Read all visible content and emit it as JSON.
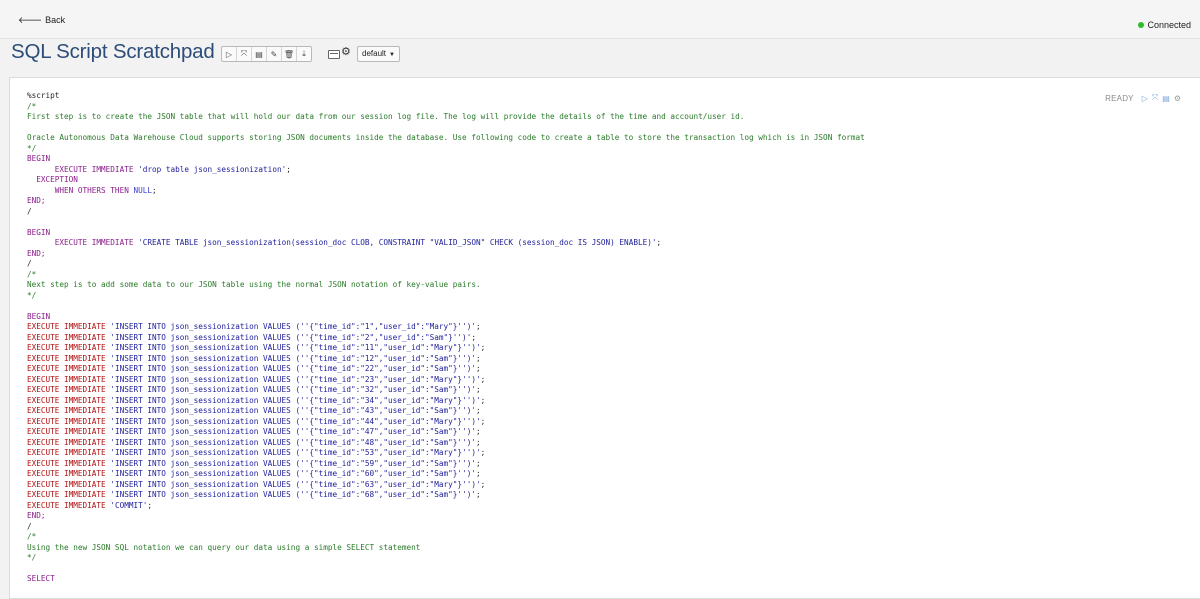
{
  "topbar": {
    "back_label": "Back",
    "status_label": "Connected",
    "status_color": "#2bbd2b"
  },
  "header": {
    "title": "SQL Script Scratchpad",
    "toolbar_icons": [
      "run-icon",
      "expand-icon",
      "book-icon",
      "eraser-icon",
      "trash-icon",
      "download-icon"
    ],
    "keyboard_icon": "keyboard-icon",
    "settings_icon": "gear-icon",
    "interpreter_select": "default"
  },
  "paragraph": {
    "status": "READY",
    "action_icons": [
      "run-icon",
      "expand-icon",
      "book-icon",
      "gear-icon"
    ],
    "lines": [
      [
        {
          "t": "%script",
          "c": "plain"
        }
      ],
      [
        {
          "t": "/*",
          "c": "com"
        }
      ],
      [
        {
          "t": "First step is to create the JSON table that will hold our data from our session log file. The log will provide the details of the time and account/user id.",
          "c": "com"
        }
      ],
      [
        {
          "t": "",
          "c": "com"
        }
      ],
      [
        {
          "t": "Oracle Autonomous Data Warehouse Cloud supports storing JSON documents inside the database. Use following code to create a table to store the transaction log which is in JSON format",
          "c": "com"
        }
      ],
      [
        {
          "t": "*/",
          "c": "com"
        }
      ],
      [
        {
          "t": "BEGIN",
          "c": "kw"
        }
      ],
      [
        {
          "t": "      EXECUTE IMMEDIATE ",
          "c": "kw"
        },
        {
          "t": "'drop table json_sessionization'",
          "c": "str"
        },
        {
          "t": ";",
          "c": "plain"
        }
      ],
      [
        {
          "t": "  EXCEPTION",
          "c": "kw"
        }
      ],
      [
        {
          "t": "      WHEN OTHERS THEN ",
          "c": "kw"
        },
        {
          "t": "NULL",
          "c": "null"
        },
        {
          "t": ";",
          "c": "plain"
        }
      ],
      [
        {
          "t": "END;",
          "c": "kw"
        }
      ],
      [
        {
          "t": "/",
          "c": "plain"
        }
      ],
      [
        {
          "t": "",
          "c": "plain"
        }
      ],
      [
        {
          "t": "BEGIN",
          "c": "kw"
        }
      ],
      [
        {
          "t": "      EXECUTE IMMEDIATE ",
          "c": "kw"
        },
        {
          "t": "'CREATE TABLE json_sessionization(session_doc CLOB, CONSTRAINT \"VALID_JSON\" CHECK (session_doc IS JSON) ENABLE)'",
          "c": "str"
        },
        {
          "t": ";",
          "c": "plain"
        }
      ],
      [
        {
          "t": "END;",
          "c": "kw"
        }
      ],
      [
        {
          "t": "/",
          "c": "plain"
        }
      ],
      [
        {
          "t": "/*",
          "c": "com"
        }
      ],
      [
        {
          "t": "Next step is to add some data to our JSON table using the normal JSON notation of key-value pairs.",
          "c": "com"
        }
      ],
      [
        {
          "t": "*/",
          "c": "com"
        }
      ],
      [
        {
          "t": "",
          "c": "plain"
        }
      ],
      [
        {
          "t": "BEGIN",
          "c": "kw"
        }
      ],
      [
        {
          "t": "EXECUTE IMMEDIATE ",
          "c": "red"
        },
        {
          "t": "'INSERT INTO json_sessionization VALUES (''{\"time_id\":\"1\",\"user_id\":\"Mary\"}'')'",
          "c": "str"
        },
        {
          "t": ";",
          "c": "plain"
        }
      ],
      [
        {
          "t": "EXECUTE IMMEDIATE ",
          "c": "red"
        },
        {
          "t": "'INSERT INTO json_sessionization VALUES (''{\"time_id\":\"2\",\"user_id\":\"Sam\"}'')'",
          "c": "str"
        },
        {
          "t": ";",
          "c": "plain"
        }
      ],
      [
        {
          "t": "EXECUTE IMMEDIATE ",
          "c": "red"
        },
        {
          "t": "'INSERT INTO json_sessionization VALUES (''{\"time_id\":\"11\",\"user_id\":\"Mary\"}'')'",
          "c": "str"
        },
        {
          "t": ";",
          "c": "plain"
        }
      ],
      [
        {
          "t": "EXECUTE IMMEDIATE ",
          "c": "red"
        },
        {
          "t": "'INSERT INTO json_sessionization VALUES (''{\"time_id\":\"12\",\"user_id\":\"Sam\"}'')'",
          "c": "str"
        },
        {
          "t": ";",
          "c": "plain"
        }
      ],
      [
        {
          "t": "EXECUTE IMMEDIATE ",
          "c": "red"
        },
        {
          "t": "'INSERT INTO json_sessionization VALUES (''{\"time_id\":\"22\",\"user_id\":\"Sam\"}'')'",
          "c": "str"
        },
        {
          "t": ";",
          "c": "plain"
        }
      ],
      [
        {
          "t": "EXECUTE IMMEDIATE ",
          "c": "red"
        },
        {
          "t": "'INSERT INTO json_sessionization VALUES (''{\"time_id\":\"23\",\"user_id\":\"Mary\"}'')'",
          "c": "str"
        },
        {
          "t": ";",
          "c": "plain"
        }
      ],
      [
        {
          "t": "EXECUTE IMMEDIATE ",
          "c": "red"
        },
        {
          "t": "'INSERT INTO json_sessionization VALUES (''{\"time_id\":\"32\",\"user_id\":\"Sam\"}'')'",
          "c": "str"
        },
        {
          "t": ";",
          "c": "plain"
        }
      ],
      [
        {
          "t": "EXECUTE IMMEDIATE ",
          "c": "red"
        },
        {
          "t": "'INSERT INTO json_sessionization VALUES (''{\"time_id\":\"34\",\"user_id\":\"Mary\"}'')'",
          "c": "str"
        },
        {
          "t": ";",
          "c": "plain"
        }
      ],
      [
        {
          "t": "EXECUTE IMMEDIATE ",
          "c": "red"
        },
        {
          "t": "'INSERT INTO json_sessionization VALUES (''{\"time_id\":\"43\",\"user_id\":\"Sam\"}'')'",
          "c": "str"
        },
        {
          "t": ";",
          "c": "plain"
        }
      ],
      [
        {
          "t": "EXECUTE IMMEDIATE ",
          "c": "red"
        },
        {
          "t": "'INSERT INTO json_sessionization VALUES (''{\"time_id\":\"44\",\"user_id\":\"Mary\"}'')'",
          "c": "str"
        },
        {
          "t": ";",
          "c": "plain"
        }
      ],
      [
        {
          "t": "EXECUTE IMMEDIATE ",
          "c": "red"
        },
        {
          "t": "'INSERT INTO json_sessionization VALUES (''{\"time_id\":\"47\",\"user_id\":\"Sam\"}'')'",
          "c": "str"
        },
        {
          "t": ";",
          "c": "plain"
        }
      ],
      [
        {
          "t": "EXECUTE IMMEDIATE ",
          "c": "red"
        },
        {
          "t": "'INSERT INTO json_sessionization VALUES (''{\"time_id\":\"48\",\"user_id\":\"Sam\"}'')'",
          "c": "str"
        },
        {
          "t": ";",
          "c": "plain"
        }
      ],
      [
        {
          "t": "EXECUTE IMMEDIATE ",
          "c": "red"
        },
        {
          "t": "'INSERT INTO json_sessionization VALUES (''{\"time_id\":\"53\",\"user_id\":\"Mary\"}'')'",
          "c": "str"
        },
        {
          "t": ";",
          "c": "plain"
        }
      ],
      [
        {
          "t": "EXECUTE IMMEDIATE ",
          "c": "red"
        },
        {
          "t": "'INSERT INTO json_sessionization VALUES (''{\"time_id\":\"59\",\"user_id\":\"Sam\"}'')'",
          "c": "str"
        },
        {
          "t": ";",
          "c": "plain"
        }
      ],
      [
        {
          "t": "EXECUTE IMMEDIATE ",
          "c": "red"
        },
        {
          "t": "'INSERT INTO json_sessionization VALUES (''{\"time_id\":\"60\",\"user_id\":\"Sam\"}'')'",
          "c": "str"
        },
        {
          "t": ";",
          "c": "plain"
        }
      ],
      [
        {
          "t": "EXECUTE IMMEDIATE ",
          "c": "red"
        },
        {
          "t": "'INSERT INTO json_sessionization VALUES (''{\"time_id\":\"63\",\"user_id\":\"Mary\"}'')'",
          "c": "str"
        },
        {
          "t": ";",
          "c": "plain"
        }
      ],
      [
        {
          "t": "EXECUTE IMMEDIATE ",
          "c": "red"
        },
        {
          "t": "'INSERT INTO json_sessionization VALUES (''{\"time_id\":\"68\",\"user_id\":\"Sam\"}'')'",
          "c": "str"
        },
        {
          "t": ";",
          "c": "plain"
        }
      ],
      [
        {
          "t": "EXECUTE IMMEDIATE ",
          "c": "red"
        },
        {
          "t": "'COMMIT'",
          "c": "str"
        },
        {
          "t": ";",
          "c": "plain"
        }
      ],
      [
        {
          "t": "END;",
          "c": "kw"
        }
      ],
      [
        {
          "t": "/",
          "c": "plain"
        }
      ],
      [
        {
          "t": "/*",
          "c": "com"
        }
      ],
      [
        {
          "t": "Using the new JSON SQL notation we can query our data using a simple SELECT statement",
          "c": "com"
        }
      ],
      [
        {
          "t": "*/",
          "c": "com"
        }
      ],
      [
        {
          "t": "",
          "c": "plain"
        }
      ],
      [
        {
          "t": "SELECT",
          "c": "kw"
        }
      ]
    ]
  }
}
